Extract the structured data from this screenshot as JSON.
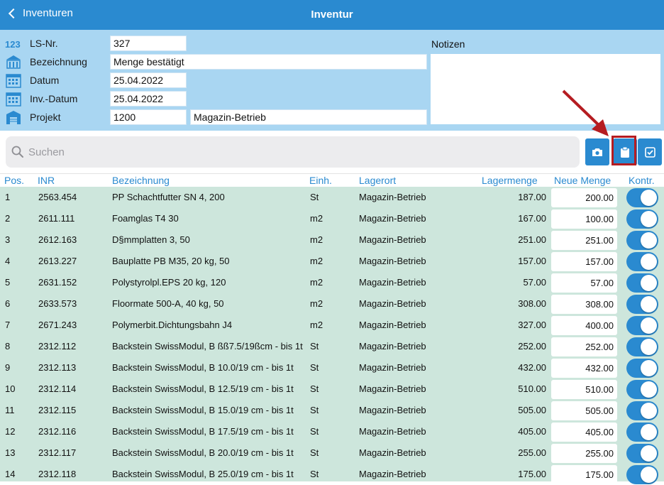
{
  "nav": {
    "back_label": "Inventuren",
    "title": "Inventur"
  },
  "form": {
    "ls_label": "LS-Nr.",
    "ls_value": "327",
    "bez_label": "Bezeichnung",
    "bez_value": "Menge bestätigt",
    "datum_label": "Datum",
    "datum_value": "25.04.2022",
    "invdatum_label": "Inv.-Datum",
    "invdatum_value": "25.04.2022",
    "projekt_label": "Projekt",
    "projekt_value": "1200",
    "projekt_name": "Magazin-Betrieb",
    "notes_label": "Notizen",
    "notes_value": ""
  },
  "search": {
    "placeholder": "Suchen"
  },
  "actions": [
    "camera-icon",
    "clipboard-icon",
    "checkbox-icon"
  ],
  "colors": {
    "accent": "#2a8ad0",
    "header_bg": "#a9d6f2",
    "row_bg": "#cde6dc",
    "highlight": "#b51c21"
  },
  "table": {
    "headers": {
      "pos": "Pos.",
      "inr": "INR",
      "bez": "Bezeichnung",
      "einh": "Einh.",
      "lagerort": "Lagerort",
      "lagermenge": "Lagermenge",
      "neue": "Neue Menge",
      "kontr": "Kontr."
    },
    "rows": [
      {
        "pos": "1",
        "inr": "2563.454",
        "bez": "PP Schachtfutter SN 4, 200",
        "einh": "St",
        "lagerort": "Magazin-Betrieb",
        "lager": "187.00",
        "neu": "200.00",
        "kontr": true
      },
      {
        "pos": "2",
        "inr": "2611.111",
        "bez": "Foamglas  T4   30",
        "einh": "m2",
        "lagerort": "Magazin-Betrieb",
        "lager": "167.00",
        "neu": "100.00",
        "kontr": true
      },
      {
        "pos": "3",
        "inr": "2612.163",
        "bez": "D§mmplatten 3, 50",
        "einh": "m2",
        "lagerort": "Magazin-Betrieb",
        "lager": "251.00",
        "neu": "251.00",
        "kontr": true
      },
      {
        "pos": "4",
        "inr": "2613.227",
        "bez": "Bauplatte PB M35, 20 kg,  50",
        "einh": "m2",
        "lagerort": "Magazin-Betrieb",
        "lager": "157.00",
        "neu": "157.00",
        "kontr": true
      },
      {
        "pos": "5",
        "inr": "2631.152",
        "bez": "Polystyrolpl.EPS 20 kg, 120",
        "einh": "m2",
        "lagerort": "Magazin-Betrieb",
        "lager": "57.00",
        "neu": "57.00",
        "kontr": true
      },
      {
        "pos": "6",
        "inr": "2633.573",
        "bez": "Floormate 500-A, 40 kg,  50",
        "einh": "m2",
        "lagerort": "Magazin-Betrieb",
        "lager": "308.00",
        "neu": "308.00",
        "kontr": true
      },
      {
        "pos": "7",
        "inr": "2671.243",
        "bez": "Polymerbit.Dichtungsbahn J4",
        "einh": "m2",
        "lagerort": "Magazin-Betrieb",
        "lager": "327.00",
        "neu": "400.00",
        "kontr": true
      },
      {
        "pos": "8",
        "inr": "2312.112",
        "bez": "Backstein SwissModul, B ßß7.5/19ßcm - bis 1t",
        "einh": "St",
        "lagerort": "Magazin-Betrieb",
        "lager": "252.00",
        "neu": "252.00",
        "kontr": true
      },
      {
        "pos": "9",
        "inr": "2312.113",
        "bez": "Backstein SwissModul, B 10.0/19 cm - bis 1t",
        "einh": "St",
        "lagerort": "Magazin-Betrieb",
        "lager": "432.00",
        "neu": "432.00",
        "kontr": true
      },
      {
        "pos": "10",
        "inr": "2312.114",
        "bez": "Backstein SwissModul, B 12.5/19 cm - bis 1t",
        "einh": "St",
        "lagerort": "Magazin-Betrieb",
        "lager": "510.00",
        "neu": "510.00",
        "kontr": true
      },
      {
        "pos": "11",
        "inr": "2312.115",
        "bez": "Backstein SwissModul, B 15.0/19 cm - bis 1t",
        "einh": "St",
        "lagerort": "Magazin-Betrieb",
        "lager": "505.00",
        "neu": "505.00",
        "kontr": true
      },
      {
        "pos": "12",
        "inr": "2312.116",
        "bez": "Backstein SwissModul, B 17.5/19 cm - bis 1t",
        "einh": "St",
        "lagerort": "Magazin-Betrieb",
        "lager": "405.00",
        "neu": "405.00",
        "kontr": true
      },
      {
        "pos": "13",
        "inr": "2312.117",
        "bez": "Backstein SwissModul, B 20.0/19 cm - bis 1t",
        "einh": "St",
        "lagerort": "Magazin-Betrieb",
        "lager": "255.00",
        "neu": "255.00",
        "kontr": true
      },
      {
        "pos": "14",
        "inr": "2312.118",
        "bez": "Backstein SwissModul, B 25.0/19 cm - bis 1t",
        "einh": "St",
        "lagerort": "Magazin-Betrieb",
        "lager": "175.00",
        "neu": "175.00",
        "kontr": true
      }
    ]
  }
}
